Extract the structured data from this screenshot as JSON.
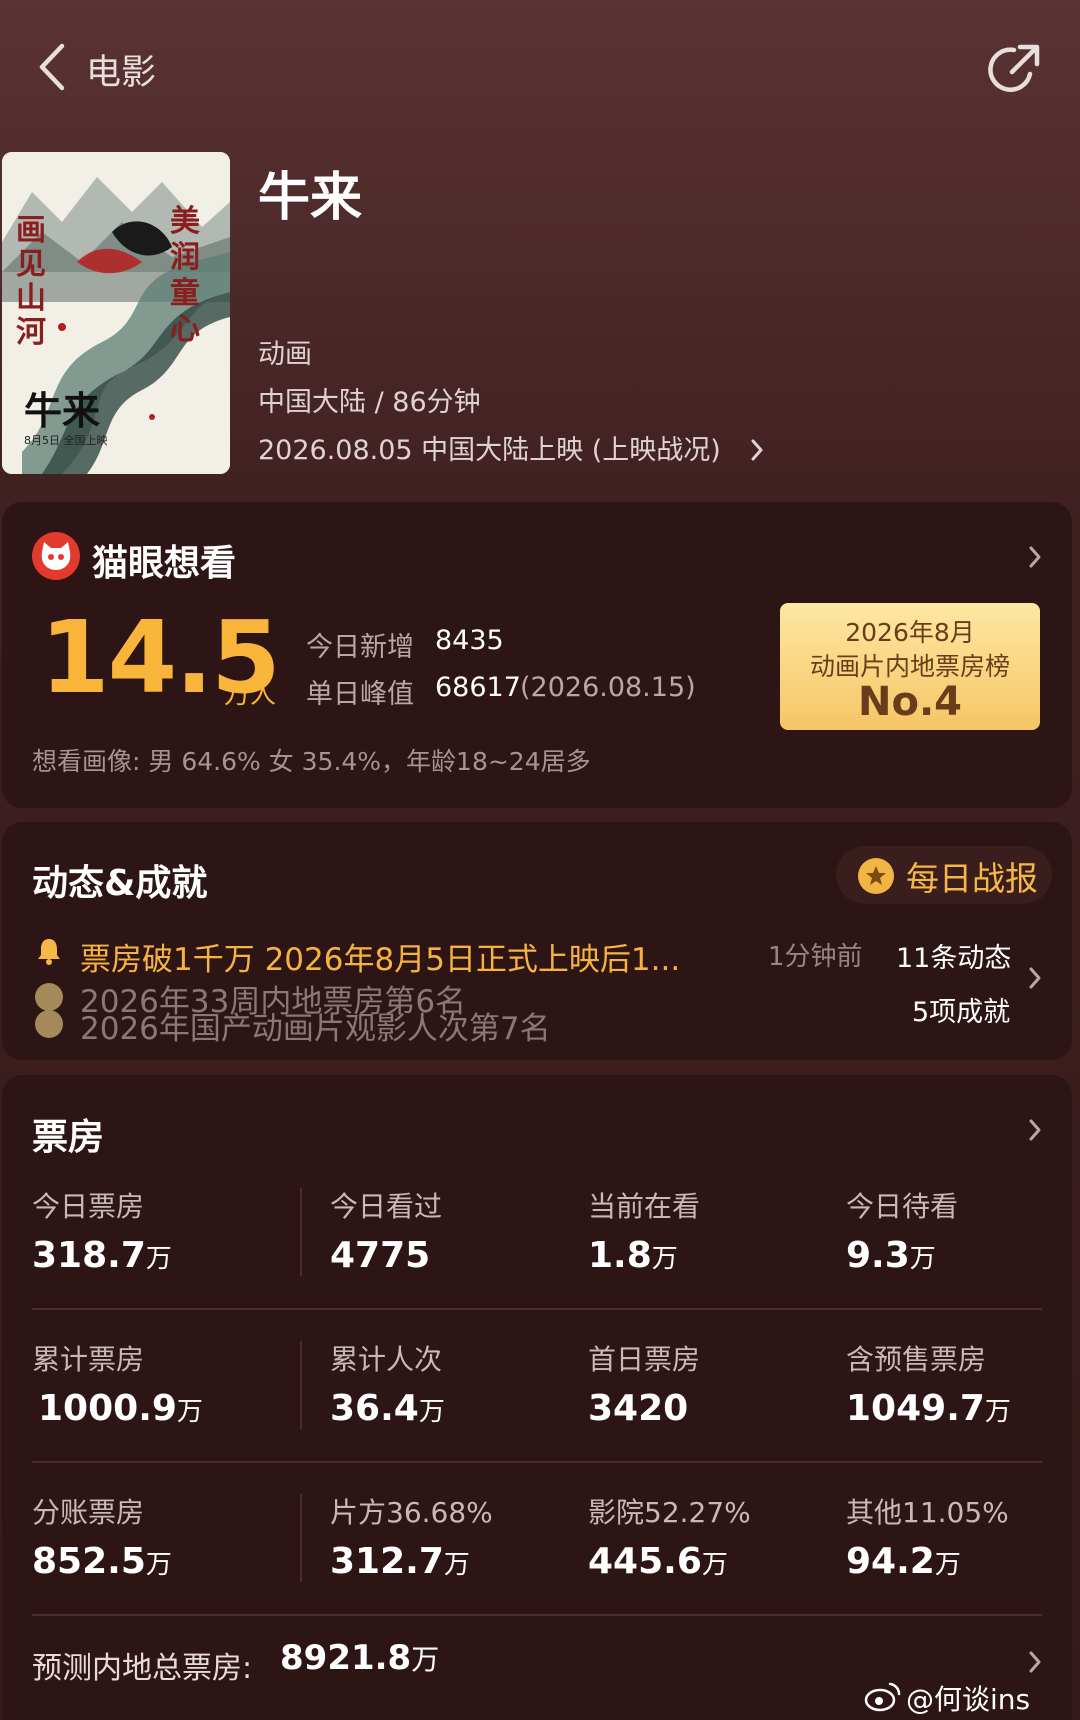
{
  "nav": {
    "back_label": "电影"
  },
  "movie": {
    "title": "牛来",
    "genre": "动画",
    "region_duration": "中国大陆 / 86分钟",
    "release": "2026.08.05 中国大陆上映 (上映战况)",
    "poster": {
      "title": "牛来",
      "slogan_left": "画见山河",
      "slogan_right": "美润童心",
      "date": "8月5日 全国上映"
    }
  },
  "want": {
    "title": "猫眼想看",
    "count": "14.5",
    "unit": "万人",
    "today_new_label": "今日新增",
    "today_new": "8435",
    "peak_label": "单日峰值",
    "peak": "68617",
    "peak_date": "(2026.08.15)",
    "portrait": "想看画像: 男 64.6%  女 35.4%，年龄18~24居多",
    "rank_line1": "2026年8月",
    "rank_line2": "动画片内地票房榜",
    "rank_no": "No.4"
  },
  "news": {
    "title": "动态&成就",
    "daily_report": "每日战报",
    "latest": "票房破1千万 2026年8月5日正式上映后1...",
    "latest_time": "1分钟前",
    "news_count": "11条动态",
    "achievement_count": "5项成就",
    "achievements": [
      "2026年33周内地票房第6名",
      "2026年国产动画片观影人次第7名"
    ]
  },
  "boxoffice": {
    "title": "票房",
    "rows": [
      [
        {
          "label": "今日票房",
          "value": "318.7",
          "unit": "万"
        },
        {
          "label": "今日看过",
          "value": "4775",
          "unit": ""
        },
        {
          "label": "当前在看",
          "value": "1.8",
          "unit": "万"
        },
        {
          "label": "今日待看",
          "value": "9.3",
          "unit": "万"
        }
      ],
      [
        {
          "label": "累计票房",
          "value": "1000.9",
          "unit": "万"
        },
        {
          "label": "累计人次",
          "value": "36.4",
          "unit": "万"
        },
        {
          "label": "首日票房",
          "value": "3420",
          "unit": ""
        },
        {
          "label": "含预售票房",
          "value": "1049.7",
          "unit": "万"
        }
      ],
      [
        {
          "label": "分账票房",
          "value": "852.5",
          "unit": "万"
        },
        {
          "label": "片方36.68%",
          "value": "312.7",
          "unit": "万"
        },
        {
          "label": "影院52.27%",
          "value": "445.6",
          "unit": "万"
        },
        {
          "label": "其他11.05%",
          "value": "94.2",
          "unit": "万"
        }
      ]
    ],
    "forecast_label": "预测内地总票房:",
    "forecast_value": "8921.8",
    "forecast_unit": "万"
  },
  "watermark": "@何谈ins",
  "colors": {
    "accent": "#f9b43a",
    "background": "#3a1c1d",
    "card": "#2d1415"
  }
}
